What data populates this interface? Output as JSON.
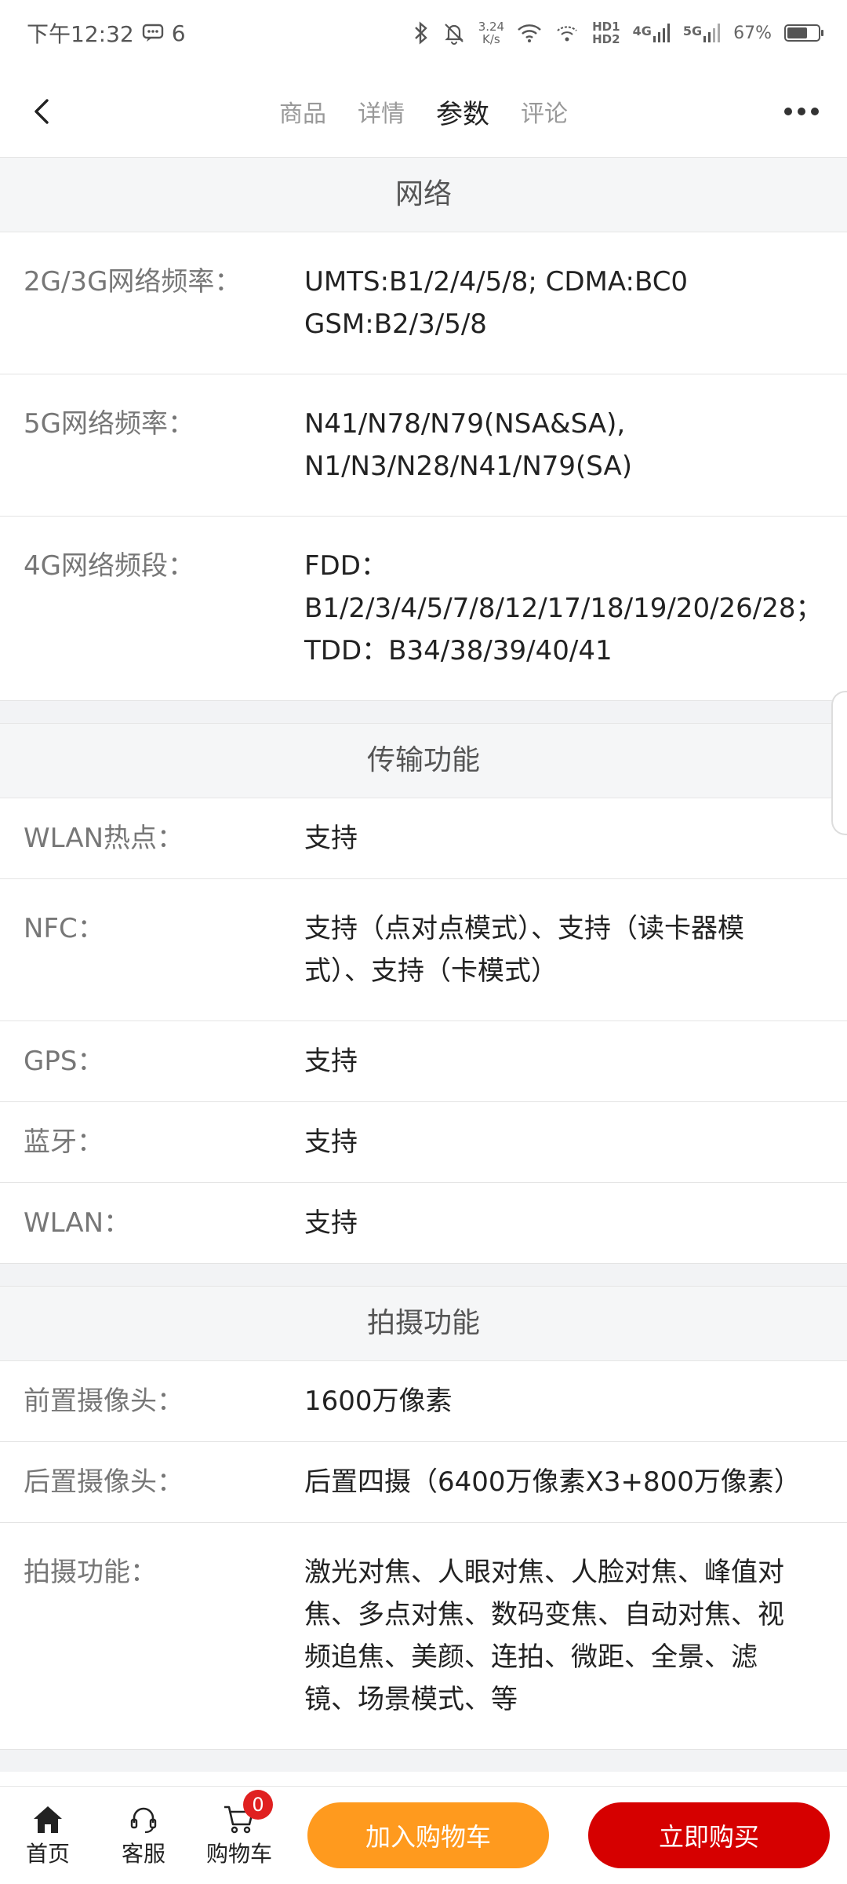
{
  "status": {
    "time": "下午12:32",
    "notif_count": "6",
    "net_speed_value": "3.24",
    "net_speed_unit": "K/s",
    "hd1": "HD1",
    "hd2": "HD2",
    "net1": "4G",
    "net2": "5G",
    "battery": "67%",
    "battery_level": 0.67
  },
  "nav": {
    "tabs": [
      "商品",
      "详情",
      "参数",
      "评论"
    ],
    "active_tab": "参数"
  },
  "sections": [
    {
      "title": "网络",
      "rows": [
        {
          "label": "2G/3G网络频率：",
          "value": "UMTS:B1/2/4/5/8; CDMA:BC0\nGSM:B2/3/5/8"
        },
        {
          "label": "5G网络频率：",
          "value": "N41/N78/N79(NSA&SA),\nN1/N3/N28/N41/N79(SA)"
        },
        {
          "label": "4G网络频段：",
          "value": "FDD：\nB1/2/3/4/5/7/8/12/17/18/19/20/26/28；\nTDD：B34/38/39/40/41"
        }
      ]
    },
    {
      "title": "传输功能",
      "rows": [
        {
          "label": "WLAN热点：",
          "value": "支持"
        },
        {
          "label": "NFC：",
          "value": "支持（点对点模式）、支持（读卡器模\n式）、支持（卡模式）"
        },
        {
          "label": "GPS：",
          "value": "支持"
        },
        {
          "label": "蓝牙：",
          "value": "支持"
        },
        {
          "label": "WLAN：",
          "value": "支持"
        }
      ]
    },
    {
      "title": "拍摄功能",
      "rows": [
        {
          "label": "前置摄像头：",
          "value": "1600万像素"
        },
        {
          "label": "后置摄像头：",
          "value": "后置四摄（6400万像素X3+800万像素）"
        },
        {
          "label": "拍摄功能：",
          "value": "激光对焦、人眼对焦、人脸对焦、峰值对\n焦、多点对焦、数码变焦、自动对焦、视\n频追焦、美颜、连拍、微距、全景、滤\n镜、场景模式、等"
        }
      ]
    }
  ],
  "bottom": {
    "home": "首页",
    "service": "客服",
    "cart": "购物车",
    "cart_count": "0",
    "add_to_cart": "加入购物车",
    "buy_now": "立即购买"
  }
}
